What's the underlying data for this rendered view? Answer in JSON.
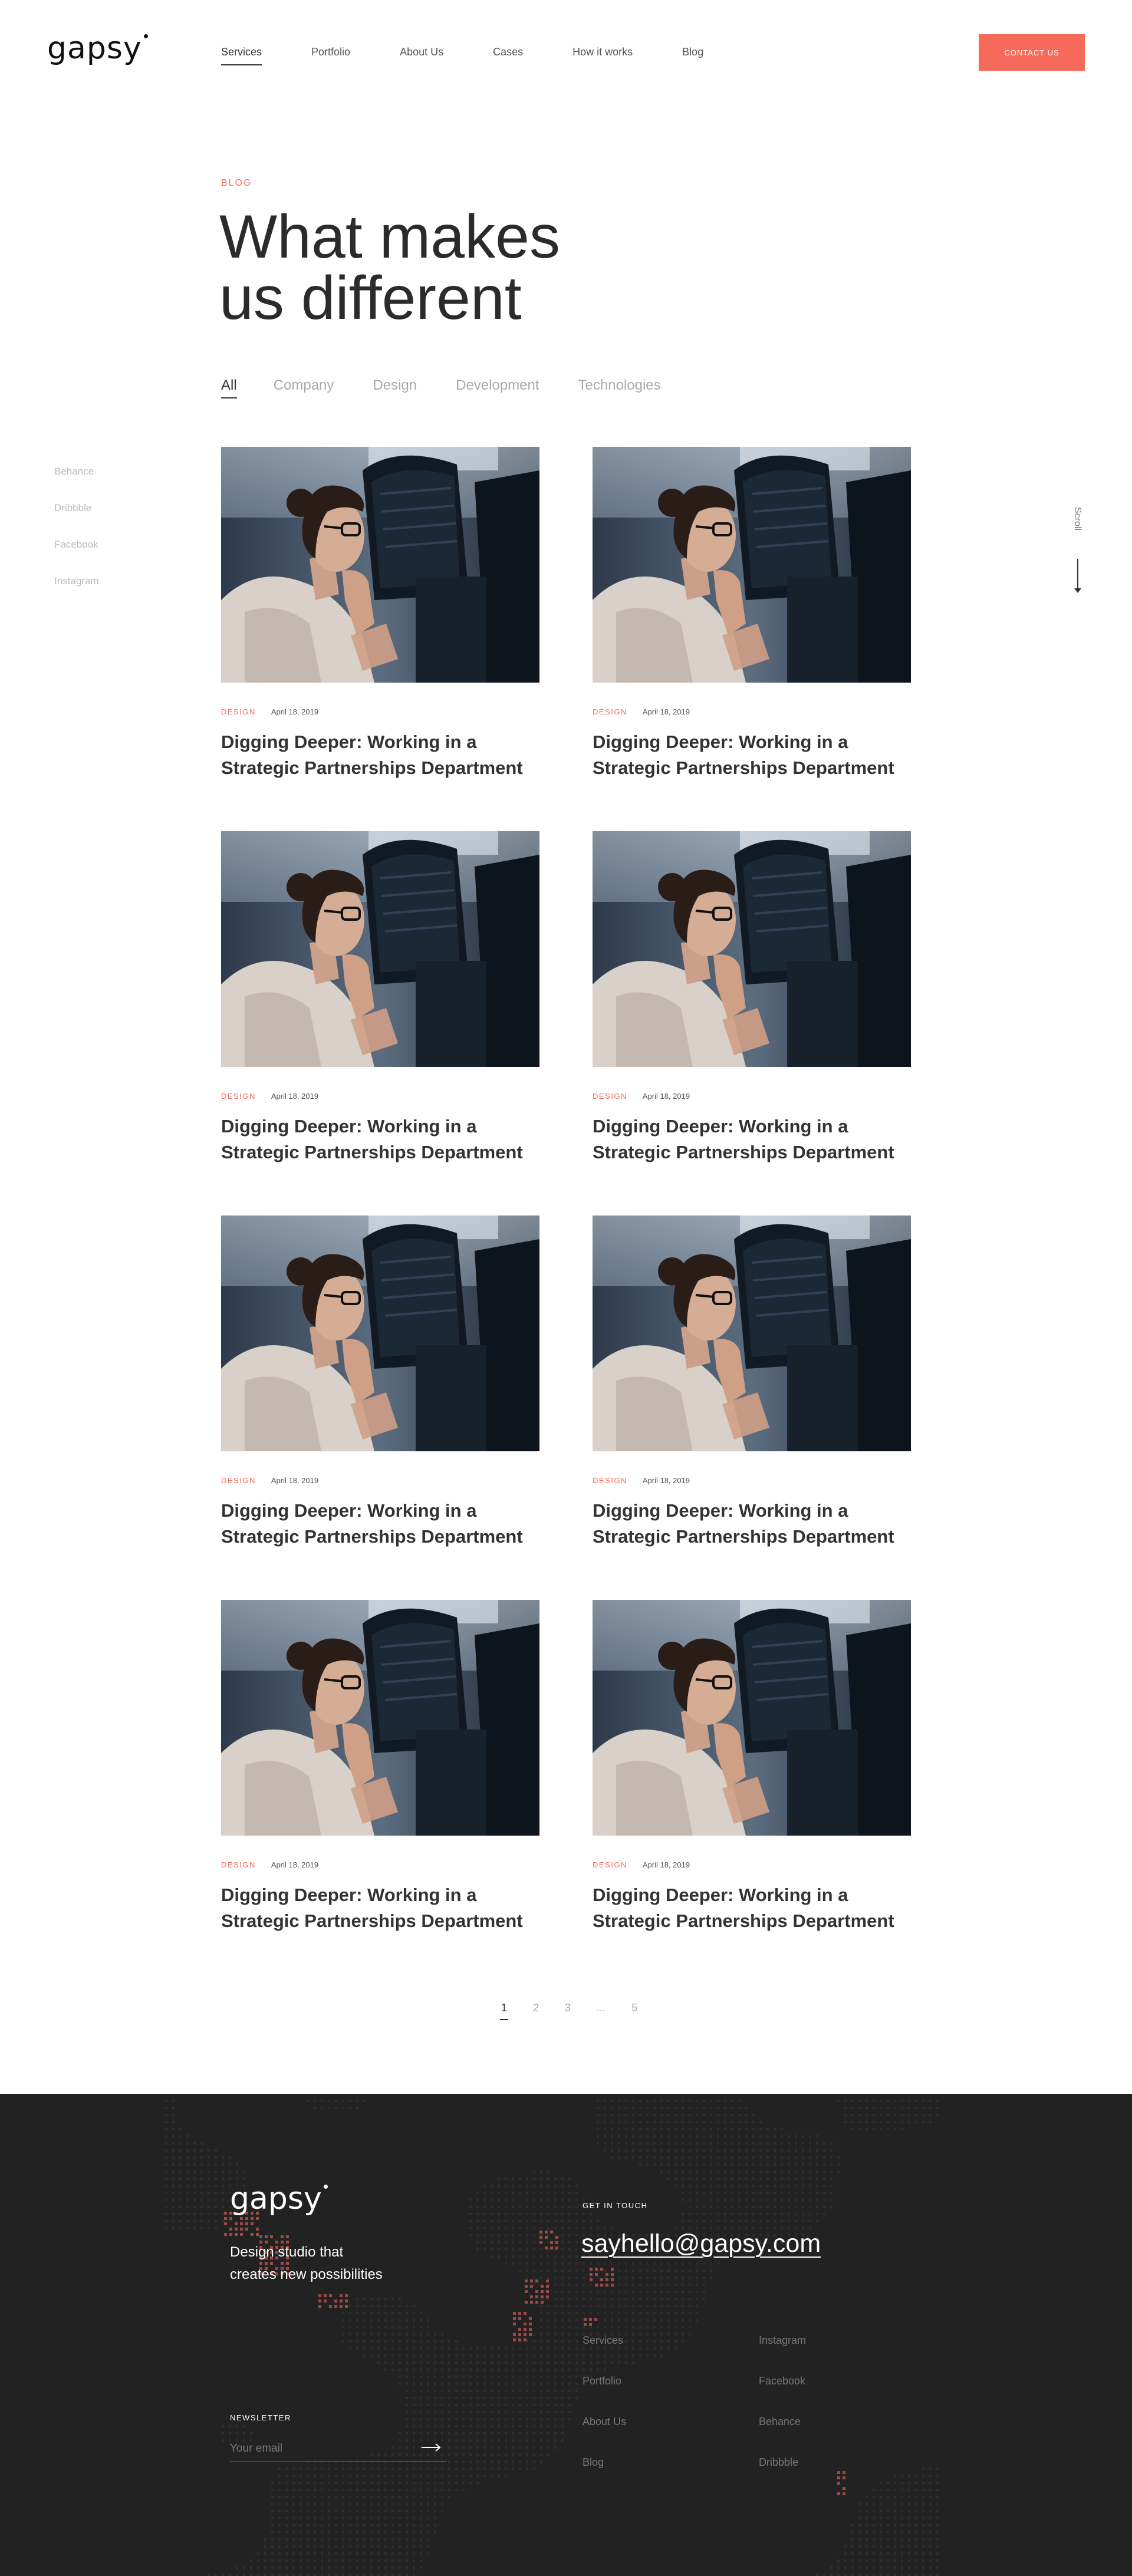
{
  "header": {
    "logo": "gapsy",
    "nav": [
      {
        "label": "Services",
        "active": true
      },
      {
        "label": "Portfolio",
        "active": false
      },
      {
        "label": "About Us",
        "active": false
      },
      {
        "label": "Cases",
        "active": false
      },
      {
        "label": "How it works",
        "active": false
      },
      {
        "label": "Blog",
        "active": false
      }
    ],
    "contact_label": "CONTACT US"
  },
  "hero": {
    "eyebrow": "BLOG",
    "title_line1": "What makes",
    "title_line2": "us different"
  },
  "filters": [
    {
      "label": "All",
      "active": true
    },
    {
      "label": "Company",
      "active": false
    },
    {
      "label": "Design",
      "active": false
    },
    {
      "label": "Development",
      "active": false
    },
    {
      "label": "Technologies",
      "active": false
    }
  ],
  "social": [
    "Behance",
    "Dribbble",
    "Facebook",
    "Instagram"
  ],
  "scroll_label": "Scroll",
  "posts": [
    {
      "category": "DESIGN",
      "date": "April 18, 2019",
      "title": "Digging Deeper: Working in a Strategic Partnerships Department"
    },
    {
      "category": "DESIGN",
      "date": "April 18, 2019",
      "title": "Digging Deeper: Working in a Strategic Partnerships Department"
    },
    {
      "category": "DESIGN",
      "date": "April 18, 2019",
      "title": "Digging Deeper: Working in a Strategic Partnerships Department"
    },
    {
      "category": "DESIGN",
      "date": "April 18, 2019",
      "title": "Digging Deeper: Working in a Strategic Partnerships Department"
    },
    {
      "category": "DESIGN",
      "date": "April 18, 2019",
      "title": "Digging Deeper: Working in a Strategic Partnerships Department"
    },
    {
      "category": "DESIGN",
      "date": "April 18, 2019",
      "title": "Digging Deeper: Working in a Strategic Partnerships Department"
    },
    {
      "category": "DESIGN",
      "date": "April 18, 2019",
      "title": "Digging Deeper: Working in a Strategic Partnerships Department"
    },
    {
      "category": "DESIGN",
      "date": "April 18, 2019",
      "title": "Digging Deeper: Working in a Strategic Partnerships Department"
    }
  ],
  "pagination": [
    {
      "label": "1",
      "active": true
    },
    {
      "label": "2",
      "active": false
    },
    {
      "label": "3",
      "active": false
    },
    {
      "label": "...",
      "active": false
    },
    {
      "label": "5",
      "active": false
    }
  ],
  "footer": {
    "logo": "gapsy",
    "tagline_line1": "Design studio that",
    "tagline_line2": "creates new possibilities",
    "newsletter_label": "NEWSLETTER",
    "email_placeholder": "Your email",
    "get_in_touch_label": "GET IN TOUCH",
    "email": "sayhello@gapsy.com",
    "links_left": [
      "Services",
      "Portfolio",
      "About Us",
      "Blog"
    ],
    "links_right": [
      "Instagram",
      "Facebook",
      "Behance",
      "Dribbble"
    ]
  },
  "colors": {
    "accent": "#f66a5c",
    "text": "#333333",
    "footer_bg": "#222223"
  }
}
